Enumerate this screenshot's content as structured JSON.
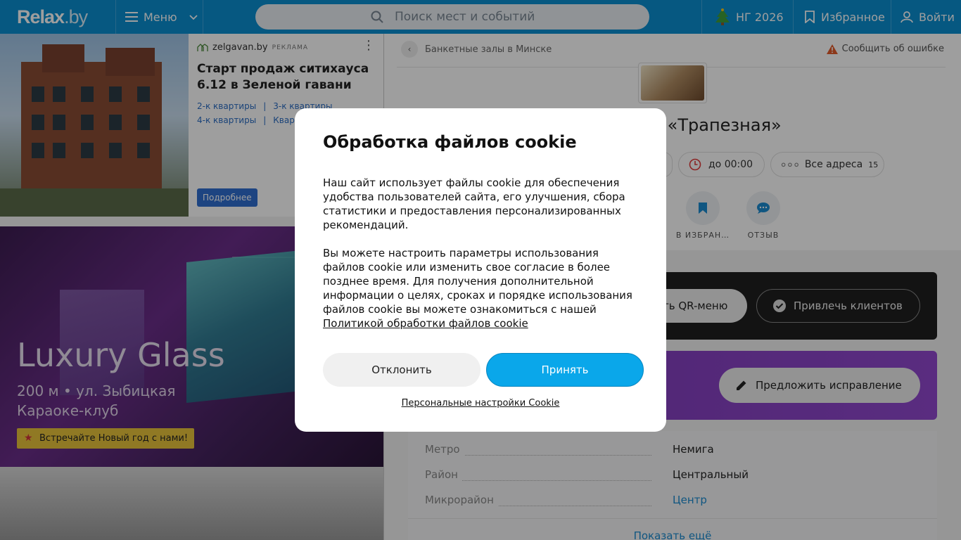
{
  "header": {
    "logo_main": "Relax",
    "logo_suffix": ".by",
    "menu_label": "Меню",
    "search_placeholder": "Поиск мест и событий",
    "ng_label": "НГ 2026",
    "favorites_label": "Избранное",
    "login_label": "Войти"
  },
  "ad": {
    "source": "zelgavan.by",
    "tag": "РЕКЛАМА",
    "title": "Старт продаж ситихауса 6.12 в Зеленой гавани",
    "links": [
      "2-к квартиры",
      "3-к квартиры",
      "4-к квартиры",
      "Квар"
    ],
    "more_label": "Подробнее"
  },
  "promo": {
    "title": "Luxury Glass",
    "line1": "200 м • ул. Зыбицкая",
    "line2": "Караоке-клуб",
    "badge": "Встречайте Новый год с нами!"
  },
  "venue": {
    "breadcrumb": "Банкетные залы в Минске",
    "report": "Сообщить об ошибке",
    "title_visible": "ал «Трапезная»",
    "hours": "до 00:00",
    "all_addresses": "Все адреса",
    "addresses_count": "15",
    "actions": [
      "В ИЗБРАН…",
      "ОТЗЫВ"
    ],
    "qr_menu": "ть QR-меню",
    "attract_clients": "Привлечь клиентов",
    "suggest_fix": "Предложить исправление",
    "info": [
      {
        "key": "Метро",
        "value": "Немига"
      },
      {
        "key": "Район",
        "value": "Центральный"
      },
      {
        "key": "Микрорайон",
        "value": "Центр"
      }
    ],
    "show_more": "Показать ещё"
  },
  "cookie_modal": {
    "title": "Обработка файлов cookie",
    "paragraph1": "Наш сайт использует файлы cookie для обеспечения удобства пользователей сайта, его улучшения, сбора статистики и предоставления персонализированных рекомендаций.",
    "paragraph2": "Вы можете настроить параметры использования файлов cookie или изменить свое согласие в более позднее время. Для получения дополнительной информации о целях, сроках и порядке использования файлов cookie вы можете ознакомиться с нашей",
    "policy_link": "Политикой обработки файлов cookie",
    "decline_label": "Отклонить",
    "accept_label": "Принять",
    "personal_settings": "Персональные настройки Cookie"
  },
  "colors": {
    "header_bg": "#0a8fd1",
    "accept_btn": "#0aa7ea",
    "promo_badge": "#e8c33a",
    "purple_bar": "#8a44c6"
  }
}
